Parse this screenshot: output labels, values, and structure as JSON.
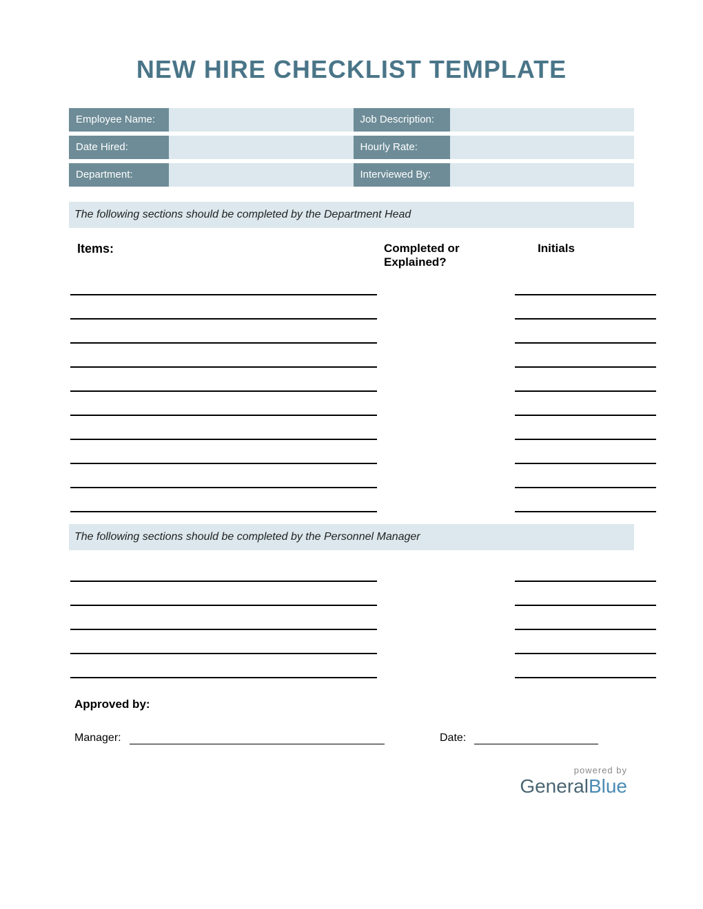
{
  "title": "NEW HIRE CHECKLIST TEMPLATE",
  "info": {
    "left": [
      {
        "label": "Employee Name:",
        "value": ""
      },
      {
        "label": "Date Hired:",
        "value": ""
      },
      {
        "label": "Department:",
        "value": ""
      }
    ],
    "right": [
      {
        "label": "Job Description:",
        "value": ""
      },
      {
        "label": "Hourly Rate:",
        "value": ""
      },
      {
        "label": "Interviewed By:",
        "value": ""
      }
    ]
  },
  "section1_banner": "The following sections should be completed by the Department Head",
  "columns": {
    "items": "Items:",
    "completed": "Completed or Explained?",
    "initials": "Initials"
  },
  "section1_rows": 10,
  "section2_banner": "The following sections should be completed by the Personnel Manager",
  "section2_rows": 5,
  "approved_label": "Approved by:",
  "manager_label": "Manager:",
  "date_label": "Date:",
  "footer": {
    "powered": "powered by",
    "brand1": "General",
    "brand2": "Blue"
  }
}
